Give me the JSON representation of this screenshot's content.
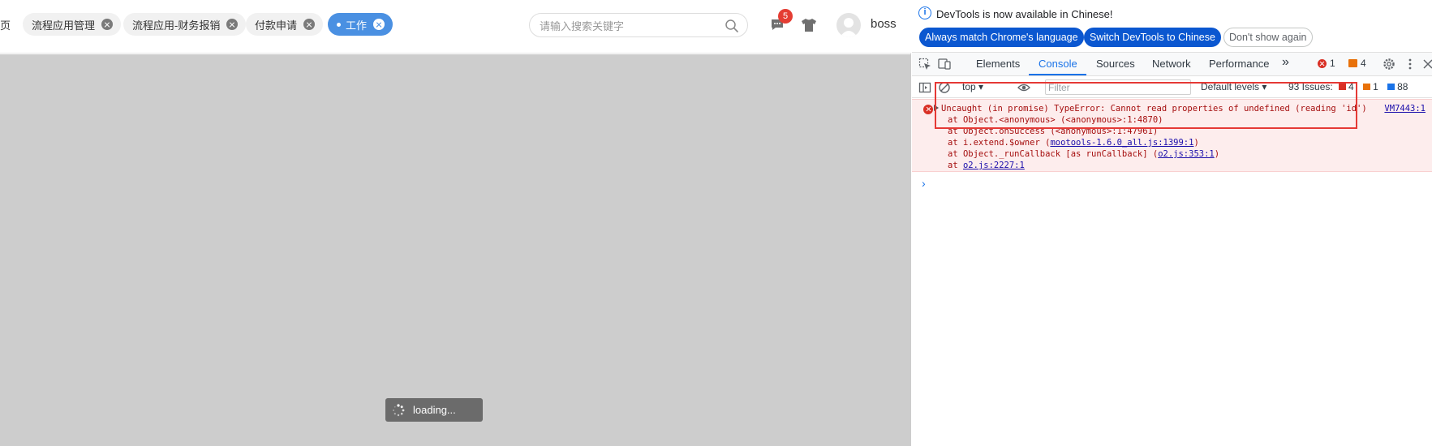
{
  "app": {
    "tab_fragment": "页",
    "tabs": [
      {
        "label": "流程应用管理"
      },
      {
        "label": "流程应用-财务报销"
      },
      {
        "label": "付款申请"
      },
      {
        "label": "工作",
        "active": true
      }
    ],
    "search": {
      "placeholder": "请输入搜索关键字",
      "value": ""
    },
    "notification_count": "5",
    "username": "boss",
    "loading_text": "loading...",
    "colors": {
      "accent": "#4a90e2",
      "badge": "#e43d33",
      "content_bg": "#cdcdcd"
    }
  },
  "devtools": {
    "info": {
      "message": "DevTools is now available in Chinese!",
      "btn_match": "Always match Chrome's language",
      "btn_switch": "Switch DevTools to Chinese",
      "btn_dismiss": "Don't show again"
    },
    "tabs": [
      "Elements",
      "Console",
      "Sources",
      "Network",
      "Performance"
    ],
    "active_tab": "Console",
    "more_tabs": "»",
    "error_count": "1",
    "warning_count": "4",
    "console_toolbar": {
      "context": "top",
      "filter_placeholder": "Filter",
      "levels": "Default levels",
      "issues_label": "93 Issues:",
      "issues_errors": "4",
      "issues_warnings": "1",
      "issues_info": "88"
    },
    "error": {
      "message": "Uncaught (in promise) TypeError: Cannot read properties of undefined (reading 'id')",
      "source_link": "VM7443:1",
      "stack": [
        {
          "prefix": "at Object.<anonymous> (<anonymous>:1:4870)",
          "link": "",
          "suffix": ""
        },
        {
          "prefix": "at Object.onSuccess (<anonymous>:1:47961)",
          "link": "",
          "suffix": ""
        },
        {
          "prefix": "at i.extend.$owner (",
          "link": "mootools-1.6.0_all.js:1399:1",
          "suffix": ")"
        },
        {
          "prefix": "at Object._runCallback [as runCallback] (",
          "link": "o2.js:353:1",
          "suffix": ")"
        },
        {
          "prefix": "at ",
          "link": "o2.js:2227:1",
          "suffix": ""
        }
      ]
    },
    "prompt": "›",
    "colors": {
      "blue": "#1a73e8",
      "error": "#d93025",
      "error_bg": "#fdeded",
      "highlight": "#e53935"
    }
  }
}
